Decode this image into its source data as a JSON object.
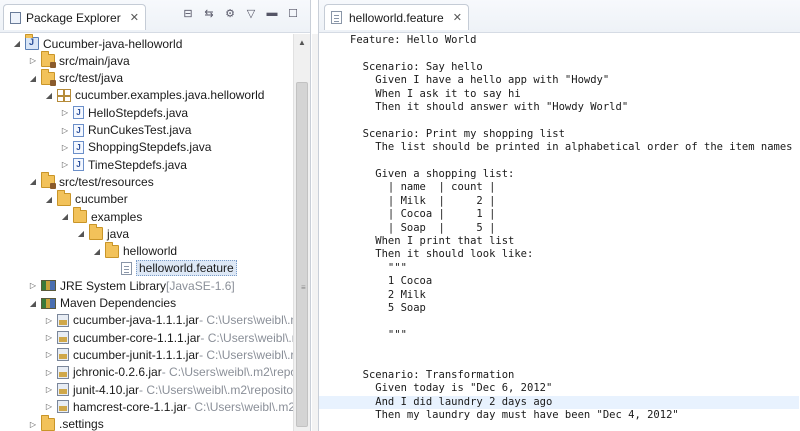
{
  "left_pane": {
    "tab_title": "Package Explorer",
    "tree": [
      {
        "label": "Cucumber-java-helloworld",
        "deco": "",
        "icon": "project-icon",
        "twisty": "expanded",
        "level": 0
      },
      {
        "label": "src/main/java",
        "deco": "",
        "icon": "source-folder-icon",
        "twisty": "collapsed",
        "level": 1
      },
      {
        "label": "src/test/java",
        "deco": "",
        "icon": "source-folder-icon",
        "twisty": "expanded",
        "level": 1
      },
      {
        "label": "cucumber.examples.java.helloworld",
        "deco": "",
        "icon": "package-icon",
        "twisty": "expanded",
        "level": 2
      },
      {
        "label": "HelloStepdefs.java",
        "deco": "",
        "icon": "java-file-icon",
        "twisty": "collapsed",
        "level": 3
      },
      {
        "label": "RunCukesTest.java",
        "deco": "",
        "icon": "java-file-icon",
        "twisty": "collapsed",
        "level": 3
      },
      {
        "label": "ShoppingStepdefs.java",
        "deco": "",
        "icon": "java-file-icon",
        "twisty": "collapsed",
        "level": 3
      },
      {
        "label": "TimeStepdefs.java",
        "deco": "",
        "icon": "java-file-icon",
        "twisty": "collapsed",
        "level": 3
      },
      {
        "label": "src/test/resources",
        "deco": "",
        "icon": "source-folder-icon",
        "twisty": "expanded",
        "level": 1
      },
      {
        "label": "cucumber",
        "deco": "",
        "icon": "folder-icon",
        "twisty": "expanded",
        "level": 2
      },
      {
        "label": "examples",
        "deco": "",
        "icon": "folder-icon",
        "twisty": "expanded",
        "level": 3
      },
      {
        "label": "java",
        "deco": "",
        "icon": "folder-icon",
        "twisty": "expanded",
        "level": 4
      },
      {
        "label": "helloworld",
        "deco": "",
        "icon": "folder-icon",
        "twisty": "expanded",
        "level": 5
      },
      {
        "label": "helloworld.feature",
        "deco": "",
        "icon": "feature-file-icon",
        "twisty": "none",
        "level": 6,
        "selected": true
      },
      {
        "label": "JRE System Library",
        "deco": "[JavaSE-1.6]",
        "icon": "library-icon",
        "twisty": "collapsed",
        "level": 1
      },
      {
        "label": "Maven Dependencies",
        "deco": "",
        "icon": "library-icon",
        "twisty": "expanded",
        "level": 1
      },
      {
        "label": "cucumber-java-1.1.1.jar",
        "deco": "- C:\\Users\\weibl\\.n",
        "icon": "jar-icon",
        "twisty": "collapsed",
        "level": 2
      },
      {
        "label": "cucumber-core-1.1.1.jar",
        "deco": "- C:\\Users\\weibl\\.n",
        "icon": "jar-icon",
        "twisty": "collapsed",
        "level": 2
      },
      {
        "label": "cucumber-junit-1.1.1.jar",
        "deco": "- C:\\Users\\weibl\\.r",
        "icon": "jar-icon",
        "twisty": "collapsed",
        "level": 2
      },
      {
        "label": "jchronic-0.2.6.jar",
        "deco": "- C:\\Users\\weibl\\.m2\\repo",
        "icon": "jar-icon",
        "twisty": "collapsed",
        "level": 2
      },
      {
        "label": "junit-4.10.jar",
        "deco": "- C:\\Users\\weibl\\.m2\\reposito",
        "icon": "jar-icon",
        "twisty": "collapsed",
        "level": 2
      },
      {
        "label": "hamcrest-core-1.1.jar",
        "deco": "- C:\\Users\\weibl\\.m2",
        "icon": "jar-icon",
        "twisty": "collapsed",
        "level": 2
      },
      {
        "label": ".settings",
        "deco": "",
        "icon": "folder-icon",
        "twisty": "collapsed",
        "level": 1
      }
    ]
  },
  "editor": {
    "tab_title": "helloworld.feature",
    "lines": [
      "Feature: Hello World",
      "",
      "  Scenario: Say hello",
      "    Given I have a hello app with \"Howdy\"",
      "    When I ask it to say hi",
      "    Then it should answer with \"Howdy World\"",
      "",
      "  Scenario: Print my shopping list",
      "    The list should be printed in alphabetical order of the item names",
      "",
      "    Given a shopping list:",
      "      | name  | count |",
      "      | Milk  |     2 |",
      "      | Cocoa |     1 |",
      "      | Soap  |     5 |",
      "    When I print that list",
      "    Then it should look like:",
      "      \"\"\"",
      "      1 Cocoa",
      "      2 Milk",
      "      5 Soap",
      "",
      "      \"\"\"",
      "",
      "",
      "  Scenario: Transformation",
      "    Given today is \"Dec 6, 2012\"",
      "    And I did laundry 2 days ago",
      "    Then my laundry day must have been \"Dec 4, 2012\""
    ],
    "highlighted_line": 27
  }
}
